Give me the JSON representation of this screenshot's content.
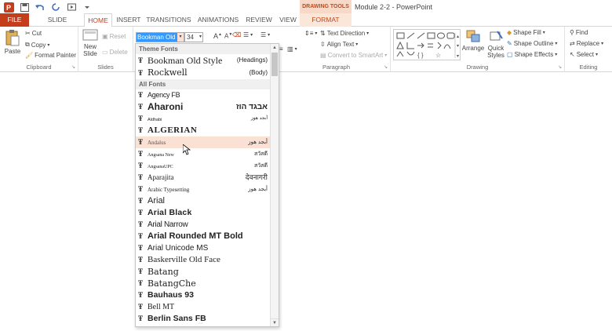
{
  "app": {
    "document_title": "Module 2-2 - PowerPoint",
    "contextual_tab_group": "DRAWING TOOLS"
  },
  "tabs": [
    {
      "label": "FILE"
    },
    {
      "label": "SLIDE MASTER"
    },
    {
      "label": "HOME"
    },
    {
      "label": "INSERT"
    },
    {
      "label": "TRANSITIONS"
    },
    {
      "label": "ANIMATIONS"
    },
    {
      "label": "REVIEW"
    },
    {
      "label": "VIEW"
    },
    {
      "label": "FORMAT"
    }
  ],
  "clipboard": {
    "paste": "Paste",
    "cut": "Cut",
    "copy": "Copy",
    "format_painter": "Format Painter",
    "label": "Clipboard"
  },
  "slides": {
    "new_slide": "New",
    "new_slide2": "Slide",
    "reset": "Reset",
    "delete": "Delete",
    "label": "Slides"
  },
  "font": {
    "name": "Bookman Old S",
    "size": "34"
  },
  "paragraph": {
    "text_direction": "Text Direction",
    "align_text": "Align Text",
    "convert_smartart": "Convert to SmartArt",
    "label": "Paragraph"
  },
  "drawing": {
    "arrange": "Arrange",
    "quick_styles": "Quick",
    "quick_styles2": "Styles",
    "shape_fill": "Shape Fill",
    "shape_outline": "Shape Outline",
    "shape_effects": "Shape Effects",
    "label": "Drawing"
  },
  "editing": {
    "find": "Find",
    "replace": "Replace",
    "select": "Select",
    "label": "Editing"
  },
  "dropdown": {
    "theme_header": "Theme Fonts",
    "theme_fonts": [
      {
        "name": "Bookman Old Style",
        "sample": "(Headings)"
      },
      {
        "name": "Rockwell",
        "sample": "(Body)"
      }
    ],
    "all_header": "All Fonts",
    "all_fonts": [
      {
        "name": "Agency FB",
        "sample": ""
      },
      {
        "name": "Aharoni",
        "sample": "אבגד הוז"
      },
      {
        "name": "Aldhabi",
        "sample": "أبجد هوز"
      },
      {
        "name": "ALGERIAN",
        "sample": ""
      },
      {
        "name": "Andalus",
        "sample": "أبجد هوز"
      },
      {
        "name": "Angsana New",
        "sample": "สวัสดี"
      },
      {
        "name": "AngsanaUPC",
        "sample": "สวัสดี"
      },
      {
        "name": "Aparajita",
        "sample": "देवनागरी"
      },
      {
        "name": "Arabic Typesetting",
        "sample": "أبجد هوز"
      },
      {
        "name": "Arial",
        "sample": ""
      },
      {
        "name": "Arial Black",
        "sample": ""
      },
      {
        "name": "Arial Narrow",
        "sample": ""
      },
      {
        "name": "Arial Rounded MT Bold",
        "sample": ""
      },
      {
        "name": "Arial Unicode MS",
        "sample": ""
      },
      {
        "name": "Baskerville Old Face",
        "sample": ""
      },
      {
        "name": "Batang",
        "sample": ""
      },
      {
        "name": "BatangChe",
        "sample": ""
      },
      {
        "name": "Bauhaus 93",
        "sample": ""
      },
      {
        "name": "Bell MT",
        "sample": ""
      },
      {
        "name": "Berlin Sans FB",
        "sample": ""
      }
    ],
    "hovered_font": "Andalus"
  },
  "colors": {
    "accent": "#c43e1c",
    "hover": "#fbe0d4"
  }
}
